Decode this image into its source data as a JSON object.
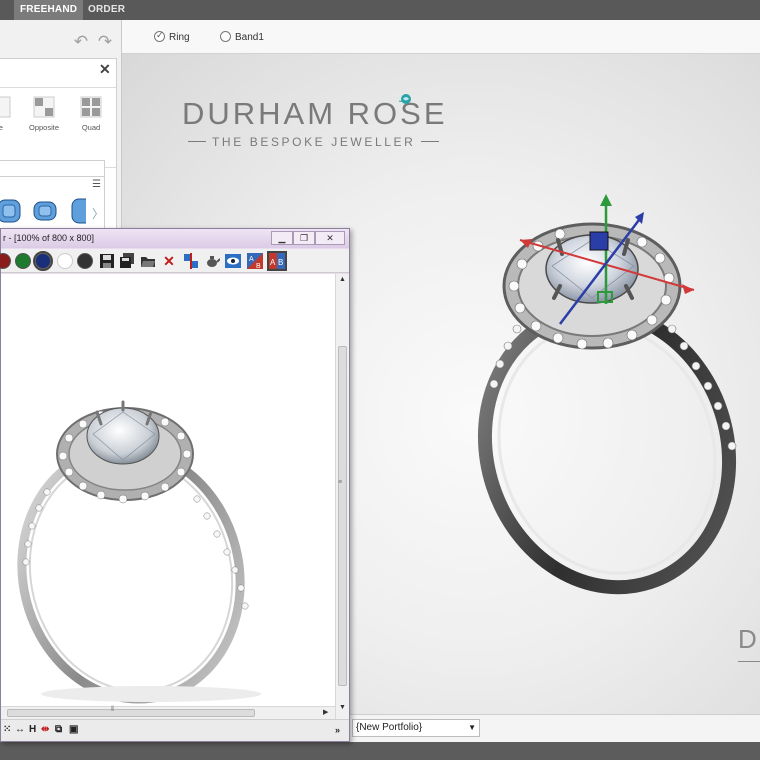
{
  "topbar": {
    "tabs": [
      {
        "label": "FREEHAND",
        "active": true
      },
      {
        "label": "ORDER",
        "active": false
      }
    ]
  },
  "left_panel": {
    "history": {
      "undo_icon": "undo-icon",
      "redo_icon": "redo-icon"
    },
    "symmetry": [
      {
        "label": "le"
      },
      {
        "label": "Opposite"
      },
      {
        "label": "Quad"
      }
    ],
    "gem_color": "#2f6fb3"
  },
  "view_options": {
    "radios": [
      {
        "label": "Ring",
        "checked": true
      },
      {
        "label": "Band1",
        "checked": false
      }
    ]
  },
  "brand": {
    "name": "DURHAM ROSE",
    "tagline": "THE BESPOKE JEWELLER",
    "corner": "D",
    "accent": "#2aa3a7"
  },
  "gizmo": {
    "x_color": "#d23a3a",
    "y_color": "#2c9a3a",
    "z_color": "#2b3ea8"
  },
  "viewer": {
    "title": "r - [100% of 800 x 800]",
    "color_swatches": [
      "#8a1c1c",
      "#1d7a2e",
      "#1a2f7a",
      "#ffffff",
      "#333333"
    ],
    "bottom_tools": [
      "H"
    ]
  },
  "bottom": {
    "portfolio_value": "{New Portfolio}"
  }
}
